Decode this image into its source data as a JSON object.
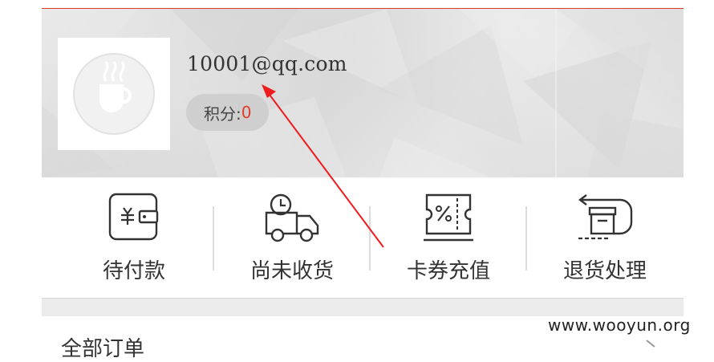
{
  "profile": {
    "email": "10001@qq.com",
    "points_label": "积分:",
    "points_value": "0"
  },
  "menu": {
    "items": [
      {
        "label": "待付款",
        "icon": "wallet-icon"
      },
      {
        "label": "尚未收货",
        "icon": "delivery-truck-icon"
      },
      {
        "label": "卡券充值",
        "icon": "coupon-ticket-icon"
      },
      {
        "label": "退货处理",
        "icon": "return-box-icon"
      }
    ]
  },
  "orders": {
    "title": "全部订单"
  },
  "watermark": {
    "text": "www.wooyun.org"
  },
  "colors": {
    "accent": "#e23b25",
    "header_bg": "#dedede",
    "icon_stroke": "#333333"
  }
}
